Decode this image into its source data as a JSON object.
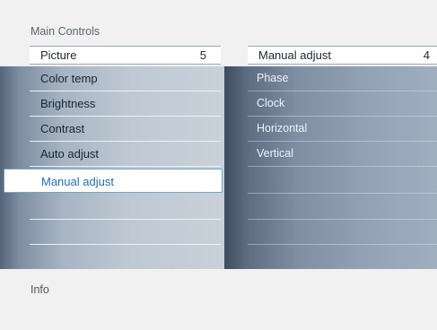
{
  "menu": {
    "title": "Main Controls",
    "header": {
      "label": "Picture",
      "value": "5"
    },
    "items": [
      {
        "label": "Color temp"
      },
      {
        "label": "Brightness"
      },
      {
        "label": "Contrast"
      },
      {
        "label": "Auto adjust"
      },
      {
        "label": "Manual adjust",
        "selected": true
      },
      {
        "label": ""
      },
      {
        "label": ""
      },
      {
        "label": ""
      }
    ]
  },
  "submenu": {
    "header": {
      "label": "Manual adjust",
      "value": "4"
    },
    "items": [
      {
        "label": "Phase"
      },
      {
        "label": "Clock"
      },
      {
        "label": "Horizontal"
      },
      {
        "label": "Vertical"
      },
      {
        "label": ""
      },
      {
        "label": ""
      },
      {
        "label": ""
      },
      {
        "label": ""
      }
    ]
  },
  "footer": {
    "info_label": "Info"
  },
  "colors": {
    "selected_text": "#1d6fb5",
    "selected_border": "#6fa6c8"
  }
}
